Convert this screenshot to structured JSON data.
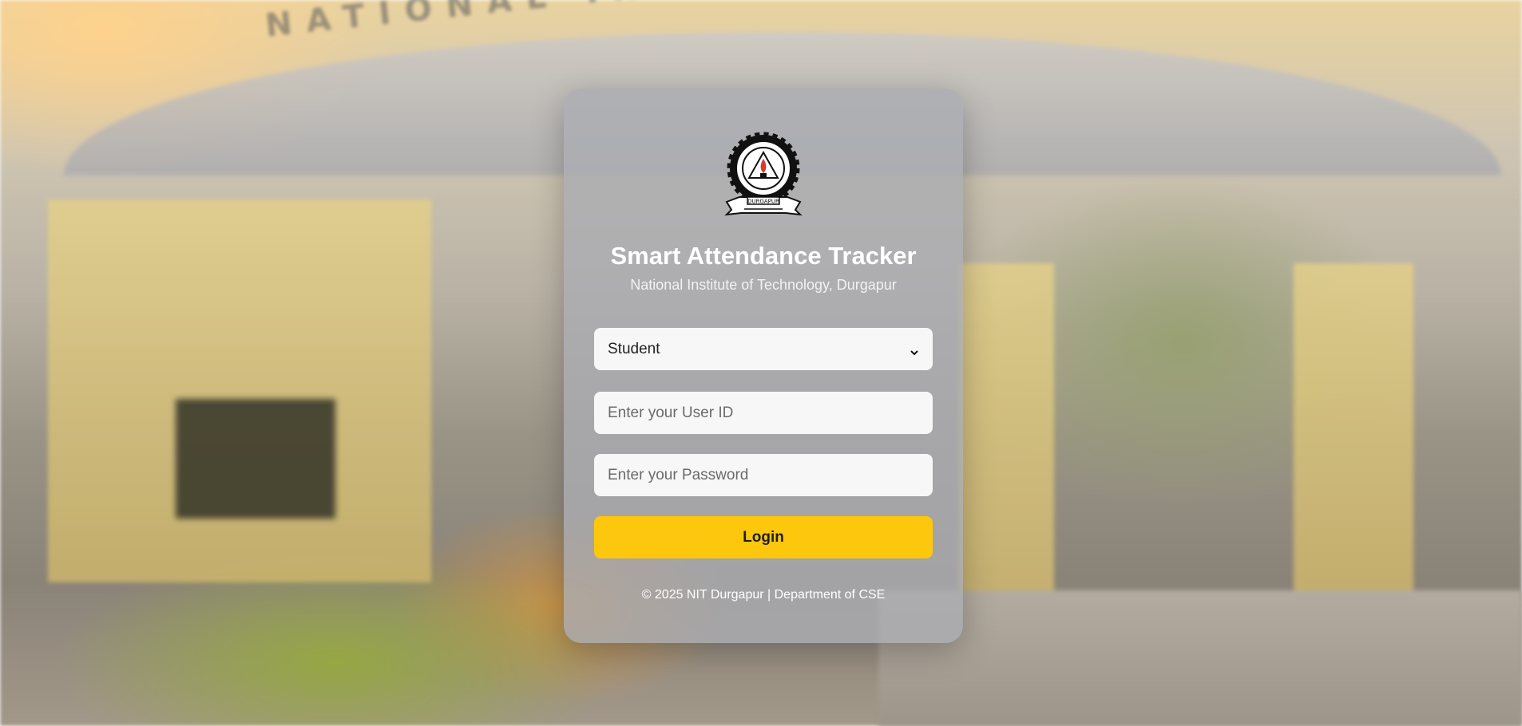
{
  "background": {
    "arch_text": "NATIONAL INSTITUTE OF TECHNOLOGY DURGAPUR"
  },
  "card": {
    "logo_icon": "nit-durgapur-emblem-icon",
    "logo_caption": "DURGAPUR",
    "title": "Smart Attendance Tracker",
    "subtitle": "National Institute of Technology, Durgapur",
    "role_select": {
      "selected": "Student"
    },
    "user_id": {
      "value": "",
      "placeholder": "Enter your User ID"
    },
    "password": {
      "value": "",
      "placeholder": "Enter your Password"
    },
    "login_label": "Login",
    "footer": "© 2025 NIT Durgapur | Department of CSE"
  },
  "colors": {
    "accent": "#fcc70d",
    "card": "#aaacb2",
    "title": "#ffffff"
  }
}
